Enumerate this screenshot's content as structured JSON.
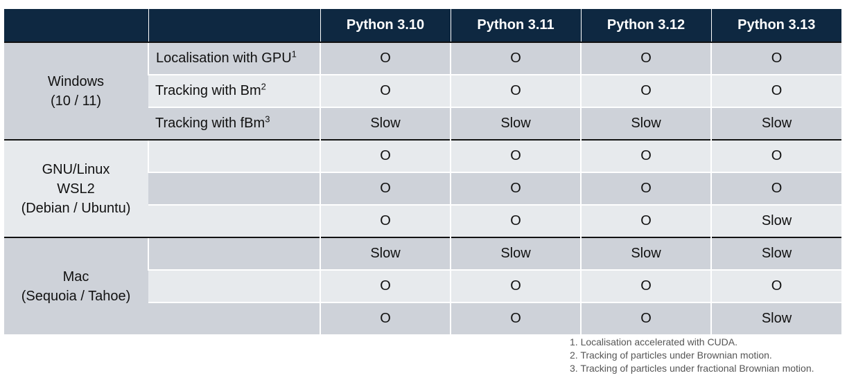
{
  "table": {
    "headers": [
      "",
      "",
      "Python 3.10",
      "Python 3.11",
      "Python 3.12",
      "Python 3.13"
    ],
    "groups": [
      {
        "os_lines": [
          "Windows",
          "(10 / 11)"
        ],
        "rows": [
          {
            "feature": "Localisation with GPU",
            "sup": "1",
            "values": [
              "O",
              "O",
              "O",
              "O"
            ]
          },
          {
            "feature": "Tracking with Bm",
            "sup": "2",
            "values": [
              "O",
              "O",
              "O",
              "O"
            ]
          },
          {
            "feature": "Tracking with fBm",
            "sup": "3",
            "values": [
              "Slow",
              "Slow",
              "Slow",
              "Slow"
            ]
          }
        ]
      },
      {
        "os_lines": [
          "GNU/Linux",
          "WSL2",
          "(Debian / Ubuntu)"
        ],
        "rows": [
          {
            "feature": "",
            "sup": "",
            "values": [
              "O",
              "O",
              "O",
              "O"
            ]
          },
          {
            "feature": "",
            "sup": "",
            "values": [
              "O",
              "O",
              "O",
              "O"
            ]
          },
          {
            "feature": "",
            "sup": "",
            "values": [
              "O",
              "O",
              "O",
              "Slow"
            ]
          }
        ]
      },
      {
        "os_lines": [
          "Mac",
          "(Sequoia / Tahoe)"
        ],
        "rows": [
          {
            "feature": "",
            "sup": "",
            "values": [
              "Slow",
              "Slow",
              "Slow",
              "Slow"
            ]
          },
          {
            "feature": "",
            "sup": "",
            "values": [
              "O",
              "O",
              "O",
              "O"
            ]
          },
          {
            "feature": "",
            "sup": "",
            "values": [
              "O",
              "O",
              "O",
              "Slow"
            ]
          }
        ]
      }
    ]
  },
  "footnotes": [
    "1. Localisation accelerated with CUDA.",
    "2. Tracking of particles under Brownian motion.",
    "3. Tracking of particles under fractional Brownian motion."
  ],
  "colors": {
    "header_bg": "#0e2841",
    "band_dark": "#ced2d9",
    "band_light": "#e7eaed",
    "group_divider": "#111111"
  }
}
